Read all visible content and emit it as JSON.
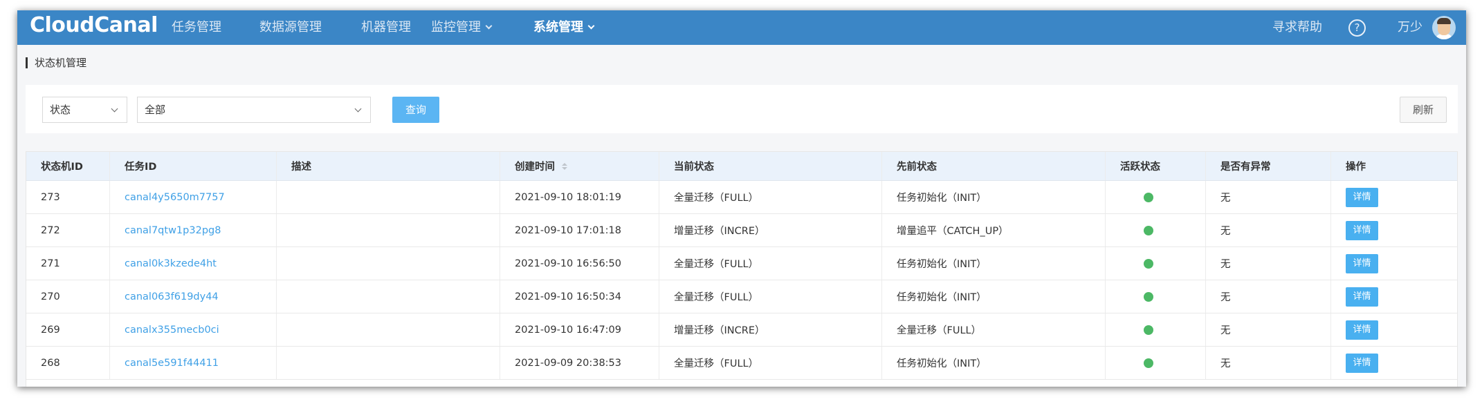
{
  "app": {
    "logo_text": "CloudCanal",
    "nav": [
      {
        "label": "任务管理"
      },
      {
        "label": "数据源管理"
      },
      {
        "label": "机器管理"
      },
      {
        "label": "监控管理"
      },
      {
        "label": "系统管理"
      }
    ],
    "help_label": "寻求帮助",
    "help_icon": "?",
    "user_name": "万少",
    "accent_color": "#3b86c6"
  },
  "page": {
    "title": "状态机管理"
  },
  "filter": {
    "field_select": "状态",
    "value_select": "全部",
    "query_label": "查询",
    "refresh_label": "刷新"
  },
  "table": {
    "columns": [
      "状态机ID",
      "任务ID",
      "描述",
      "创建时间",
      "当前状态",
      "先前状态",
      "活跃状态",
      "是否有异常",
      "操作"
    ],
    "rows": [
      {
        "id": "273",
        "task_id": "canal4y5650m7757",
        "desc": "",
        "created": "2021-09-10 18:01:19",
        "current": "全量迁移（FULL）",
        "previous": "任务初始化（INIT）",
        "exception": "无",
        "action": "详情"
      },
      {
        "id": "272",
        "task_id": "canal7qtw1p32pg8",
        "desc": "",
        "created": "2021-09-10 17:01:18",
        "current": "增量迁移（INCRE）",
        "previous": "增量追平（CATCH_UP）",
        "exception": "无",
        "action": "详情"
      },
      {
        "id": "271",
        "task_id": "canal0k3kzede4ht",
        "desc": "",
        "created": "2021-09-10 16:56:50",
        "current": "全量迁移（FULL）",
        "previous": "任务初始化（INIT）",
        "exception": "无",
        "action": "详情"
      },
      {
        "id": "270",
        "task_id": "canal063f619dy44",
        "desc": "",
        "created": "2021-09-10 16:50:34",
        "current": "全量迁移（FULL）",
        "previous": "任务初始化（INIT）",
        "exception": "无",
        "action": "详情"
      },
      {
        "id": "269",
        "task_id": "canalx355mecb0ci",
        "desc": "",
        "created": "2021-09-10 16:47:09",
        "current": "增量迁移（INCRE）",
        "previous": "全量迁移（FULL）",
        "exception": "无",
        "action": "详情"
      },
      {
        "id": "268",
        "task_id": "canal5e591f44411",
        "desc": "",
        "created": "2021-09-09 20:38:53",
        "current": "全量迁移（FULL）",
        "previous": "任务初始化（INIT）",
        "exception": "无",
        "action": "详情"
      }
    ],
    "active_color": "#4cb865"
  }
}
